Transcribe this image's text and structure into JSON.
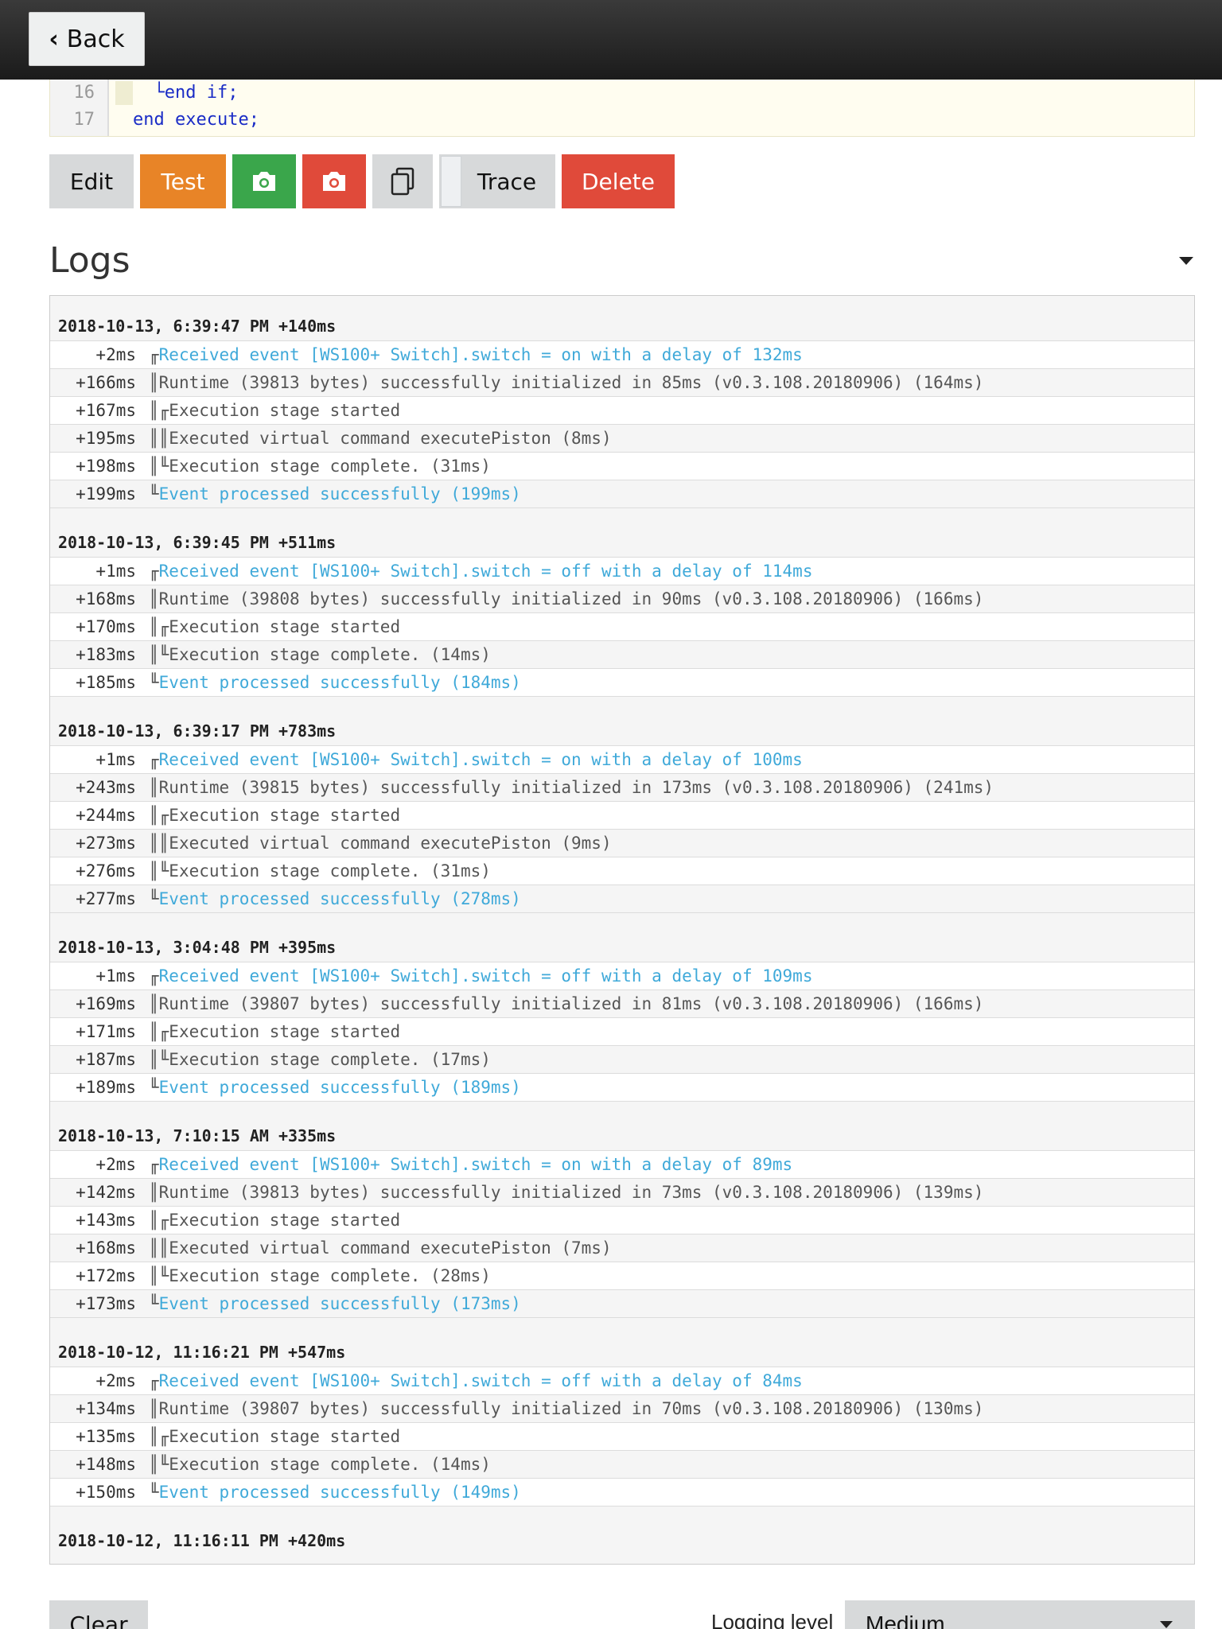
{
  "header": {
    "back_label": "Back"
  },
  "code": {
    "line_numbers": [
      "16",
      "17"
    ],
    "lines": [
      "  └end if;",
      "end execute;"
    ]
  },
  "toolbar": {
    "edit": "Edit",
    "test": "Test",
    "trace": "Trace",
    "delete": "Delete",
    "snapshot_green_icon": "camera-icon",
    "snapshot_red_icon": "camera-icon",
    "duplicate_icon": "duplicate-icon"
  },
  "logs": {
    "title": "Logs",
    "groups": [
      {
        "timestamp": "2018-10-13, 6:39:47 PM +140ms",
        "rows": [
          {
            "t": "+2ms",
            "tree": "╓",
            "msg": "Received event [WS100+ Switch].switch = on with a delay of 132ms",
            "info": true
          },
          {
            "t": "+166ms",
            "tree": "║",
            "msg": "Runtime (39813 bytes) successfully initialized in 85ms (v0.3.108.20180906) (164ms)",
            "info": false
          },
          {
            "t": "+167ms",
            "tree": "║╓",
            "msg": "Execution stage started",
            "info": false
          },
          {
            "t": "+195ms",
            "tree": "║║",
            "msg": "Executed virtual command executePiston (8ms)",
            "info": false
          },
          {
            "t": "+198ms",
            "tree": "║╙",
            "msg": "Execution stage complete. (31ms)",
            "info": false
          },
          {
            "t": "+199ms",
            "tree": "╙",
            "msg": "Event processed successfully (199ms)",
            "info": true
          }
        ]
      },
      {
        "timestamp": "2018-10-13, 6:39:45 PM +511ms",
        "rows": [
          {
            "t": "+1ms",
            "tree": "╓",
            "msg": "Received event [WS100+ Switch].switch = off with a delay of 114ms",
            "info": true
          },
          {
            "t": "+168ms",
            "tree": "║",
            "msg": "Runtime (39808 bytes) successfully initialized in 90ms (v0.3.108.20180906) (166ms)",
            "info": false
          },
          {
            "t": "+170ms",
            "tree": "║╓",
            "msg": "Execution stage started",
            "info": false
          },
          {
            "t": "+183ms",
            "tree": "║╙",
            "msg": "Execution stage complete. (14ms)",
            "info": false
          },
          {
            "t": "+185ms",
            "tree": "╙",
            "msg": "Event processed successfully (184ms)",
            "info": true
          }
        ]
      },
      {
        "timestamp": "2018-10-13, 6:39:17 PM +783ms",
        "rows": [
          {
            "t": "+1ms",
            "tree": "╓",
            "msg": "Received event [WS100+ Switch].switch = on with a delay of 100ms",
            "info": true
          },
          {
            "t": "+243ms",
            "tree": "║",
            "msg": "Runtime (39815 bytes) successfully initialized in 173ms (v0.3.108.20180906) (241ms)",
            "info": false
          },
          {
            "t": "+244ms",
            "tree": "║╓",
            "msg": "Execution stage started",
            "info": false
          },
          {
            "t": "+273ms",
            "tree": "║║",
            "msg": "Executed virtual command executePiston (9ms)",
            "info": false
          },
          {
            "t": "+276ms",
            "tree": "║╙",
            "msg": "Execution stage complete. (31ms)",
            "info": false
          },
          {
            "t": "+277ms",
            "tree": "╙",
            "msg": "Event processed successfully (278ms)",
            "info": true
          }
        ]
      },
      {
        "timestamp": "2018-10-13, 3:04:48 PM +395ms",
        "rows": [
          {
            "t": "+1ms",
            "tree": "╓",
            "msg": "Received event [WS100+ Switch].switch = off with a delay of 109ms",
            "info": true
          },
          {
            "t": "+169ms",
            "tree": "║",
            "msg": "Runtime (39807 bytes) successfully initialized in 81ms (v0.3.108.20180906) (166ms)",
            "info": false
          },
          {
            "t": "+171ms",
            "tree": "║╓",
            "msg": "Execution stage started",
            "info": false
          },
          {
            "t": "+187ms",
            "tree": "║╙",
            "msg": "Execution stage complete. (17ms)",
            "info": false
          },
          {
            "t": "+189ms",
            "tree": "╙",
            "msg": "Event processed successfully (189ms)",
            "info": true
          }
        ]
      },
      {
        "timestamp": "2018-10-13, 7:10:15 AM +335ms",
        "rows": [
          {
            "t": "+2ms",
            "tree": "╓",
            "msg": "Received event [WS100+ Switch].switch = on with a delay of 89ms",
            "info": true
          },
          {
            "t": "+142ms",
            "tree": "║",
            "msg": "Runtime (39813 bytes) successfully initialized in 73ms (v0.3.108.20180906) (139ms)",
            "info": false
          },
          {
            "t": "+143ms",
            "tree": "║╓",
            "msg": "Execution stage started",
            "info": false
          },
          {
            "t": "+168ms",
            "tree": "║║",
            "msg": "Executed virtual command executePiston (7ms)",
            "info": false
          },
          {
            "t": "+172ms",
            "tree": "║╙",
            "msg": "Execution stage complete. (28ms)",
            "info": false
          },
          {
            "t": "+173ms",
            "tree": "╙",
            "msg": "Event processed successfully (173ms)",
            "info": true
          }
        ]
      },
      {
        "timestamp": "2018-10-12, 11:16:21 PM +547ms",
        "rows": [
          {
            "t": "+2ms",
            "tree": "╓",
            "msg": "Received event [WS100+ Switch].switch = off with a delay of 84ms",
            "info": true
          },
          {
            "t": "+134ms",
            "tree": "║",
            "msg": "Runtime (39807 bytes) successfully initialized in 70ms (v0.3.108.20180906) (130ms)",
            "info": false
          },
          {
            "t": "+135ms",
            "tree": "║╓",
            "msg": "Execution stage started",
            "info": false
          },
          {
            "t": "+148ms",
            "tree": "║╙",
            "msg": "Execution stage complete. (14ms)",
            "info": false
          },
          {
            "t": "+150ms",
            "tree": "╙",
            "msg": "Event processed successfully (149ms)",
            "info": true
          }
        ]
      },
      {
        "timestamp": "2018-10-12, 11:16:11 PM +420ms",
        "rows": []
      }
    ]
  },
  "footer": {
    "clear_label": "Clear",
    "level_label": "Logging level",
    "level_value": "Medium"
  }
}
